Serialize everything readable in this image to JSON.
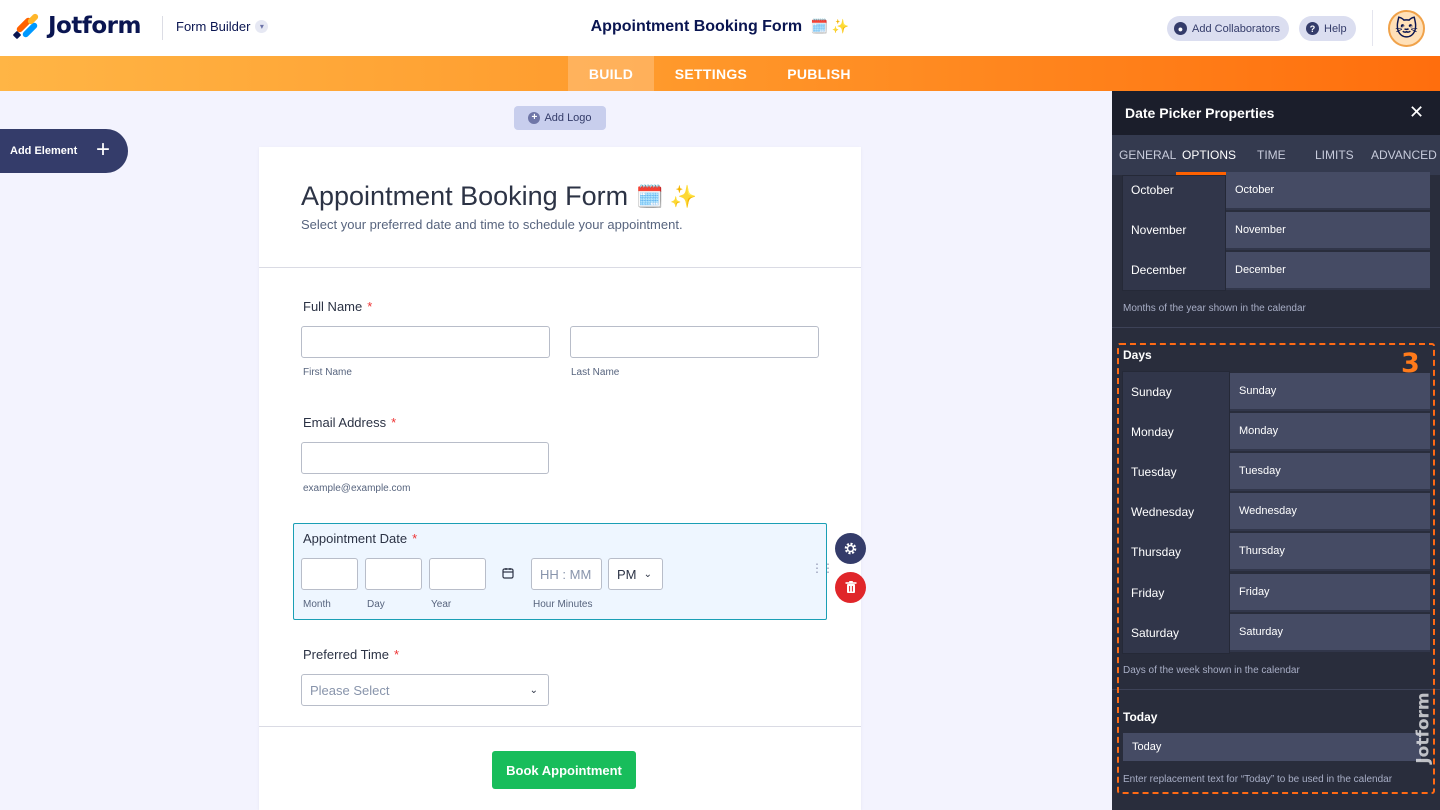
{
  "header": {
    "brand": "Jotform",
    "mode_label": "Form Builder",
    "form_title": "Appointment Booking Form",
    "title_emojis": "🗓️ ✨",
    "collaborators_label": "Add Collaborators",
    "help_label": "Help"
  },
  "nav": {
    "tabs": [
      {
        "label": "BUILD",
        "active": true
      },
      {
        "label": "SETTINGS",
        "active": false
      },
      {
        "label": "PUBLISH",
        "active": false
      }
    ]
  },
  "canvas": {
    "add_logo": "Add Logo",
    "add_element": "Add Element"
  },
  "form": {
    "title": "Appointment Booking Form",
    "title_emojis": "🗓️ ✨",
    "subtitle": "Select your preferred date and time to schedule your appointment.",
    "full_name": {
      "label": "Full Name",
      "required": "*",
      "first_sublabel": "First Name",
      "last_sublabel": "Last Name"
    },
    "email": {
      "label": "Email Address",
      "required": "*",
      "sublabel": "example@example.com"
    },
    "date": {
      "label": "Appointment Date",
      "required": "*",
      "sub_month": "Month",
      "sub_day": "Day",
      "sub_year": "Year",
      "time_placeholder": "HH : MM",
      "ampm": "PM",
      "sub_time": "Hour Minutes"
    },
    "time": {
      "label": "Preferred Time",
      "required": "*",
      "placeholder": "Please Select"
    },
    "submit": "Book Appointment"
  },
  "panel": {
    "title": "Date Picker Properties",
    "tabs": [
      "GENERAL",
      "OPTIONS",
      "TIME",
      "LIMITS",
      "ADVANCED"
    ],
    "active_tab": "OPTIONS",
    "months": [
      {
        "label": "October",
        "value": "October"
      },
      {
        "label": "November",
        "value": "November"
      },
      {
        "label": "December",
        "value": "December"
      }
    ],
    "months_help": "Months of the year shown in the calendar",
    "days_title": "Days",
    "days": [
      {
        "label": "Sunday",
        "value": "Sunday"
      },
      {
        "label": "Monday",
        "value": "Monday"
      },
      {
        "label": "Tuesday",
        "value": "Tuesday"
      },
      {
        "label": "Wednesday",
        "value": "Wednesday"
      },
      {
        "label": "Thursday",
        "value": "Thursday"
      },
      {
        "label": "Friday",
        "value": "Friday"
      },
      {
        "label": "Saturday",
        "value": "Saturday"
      }
    ],
    "days_help": "Days of the week shown in the calendar",
    "today_title": "Today",
    "today_value": "Today",
    "today_help": "Enter replacement text for “Today” to be used in the calendar"
  },
  "annotation": {
    "step": "3",
    "highlight_color": "#ff6a14"
  },
  "watermark": "Jotform"
}
